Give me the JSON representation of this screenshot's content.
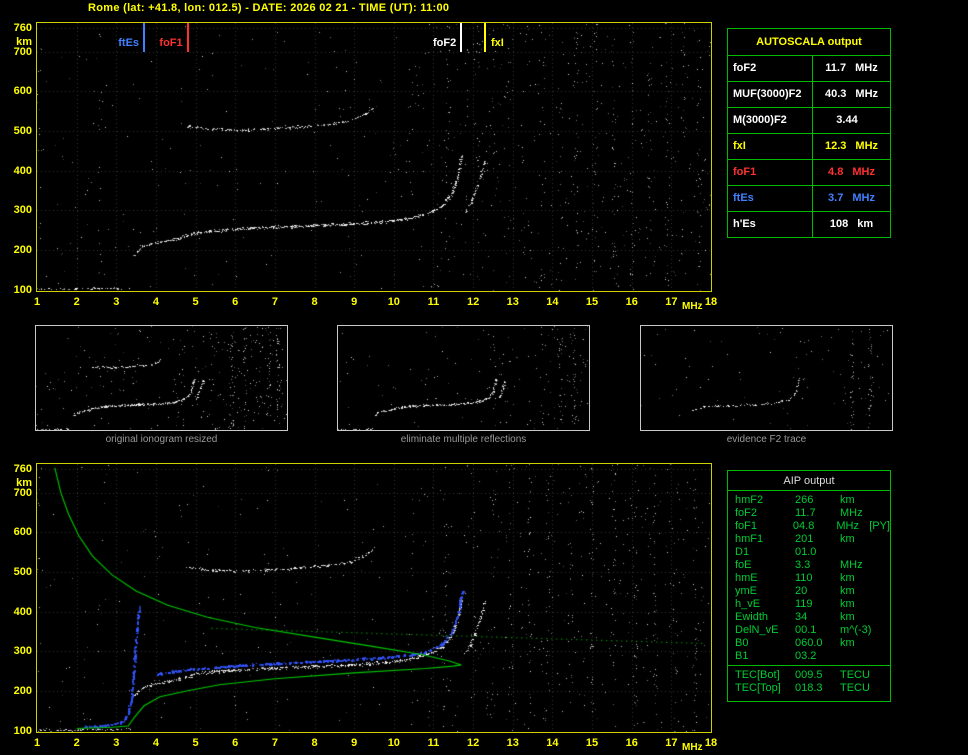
{
  "app": {
    "title": "Rome (lat: +41.8, lon: 012.5) - DATE: 2026 02 21 - TIME (UT): 11:00"
  },
  "autoscala_table": {
    "title": "AUTOSCALA output",
    "rows": [
      {
        "label": "foF2",
        "value": "11.7",
        "unit": "MHz",
        "color": "#ffffff"
      },
      {
        "label": "MUF(3000)F2",
        "value": "40.3",
        "unit": "MHz",
        "color": "#ffffff"
      },
      {
        "label": "M(3000)F2",
        "value": "3.44",
        "unit": "",
        "color": "#ffffff"
      },
      {
        "label": "fxI",
        "value": "12.3",
        "unit": "MHz",
        "color": "#ffff00"
      },
      {
        "label": "foF1",
        "value": "4.8",
        "unit": "MHz",
        "color": "#ff3030"
      },
      {
        "label": "ftEs",
        "value": "3.7",
        "unit": "MHz",
        "color": "#4080ff"
      },
      {
        "label": "h'Es",
        "value": "108",
        "unit": "km",
        "color": "#ffffff"
      }
    ]
  },
  "aip_table": {
    "title": "AIP output",
    "rows": [
      {
        "label": "hmF2",
        "value": "266",
        "unit": "km"
      },
      {
        "label": "foF2",
        "value": "11.7",
        "unit": "MHz"
      },
      {
        "label": "foF1",
        "value": "04.8",
        "unit": "MHz",
        "note": "[PY]"
      },
      {
        "label": "hmF1",
        "value": "201",
        "unit": "km"
      },
      {
        "label": "D1",
        "value": "01.0",
        "unit": ""
      },
      {
        "label": "foE",
        "value": "3.3",
        "unit": "MHz"
      },
      {
        "label": "hmE",
        "value": "110",
        "unit": "km"
      },
      {
        "label": "ymE",
        "value": "20",
        "unit": "km"
      },
      {
        "label": "h_vE",
        "value": "119",
        "unit": "km"
      },
      {
        "label": "Ewidth",
        "value": "34",
        "unit": "km"
      },
      {
        "label": "DelN_vE",
        "value": "00.1",
        "unit": "m^(-3)"
      },
      {
        "label": "B0",
        "value": "060.0",
        "unit": "km"
      },
      {
        "label": "B1",
        "value": "03.2",
        "unit": ""
      }
    ],
    "tec_rows": [
      {
        "label": "TEC[Bot]",
        "value": "009.5",
        "unit": "TECU"
      },
      {
        "label": "TEC[Top]",
        "value": "018.3",
        "unit": "TECU"
      }
    ]
  },
  "thumbnails": [
    {
      "caption": "original ionogram resized"
    },
    {
      "caption": "eliminate multiple reflections"
    },
    {
      "caption": "evidence F2 trace"
    }
  ],
  "chart_data": [
    {
      "id": "main_ionogram",
      "type": "scatter",
      "title": "vertical incidence ionogram",
      "xlabel": "MHz",
      "ylabel": "km",
      "xlim": [
        1,
        18
      ],
      "ylim": [
        97,
        772
      ],
      "x_ticks": [
        1,
        2,
        3,
        4,
        5,
        6,
        7,
        8,
        9,
        10,
        11,
        12,
        13,
        14,
        15,
        16,
        17,
        18
      ],
      "y_ticks": [
        760,
        700,
        600,
        500,
        400,
        300,
        200,
        100
      ],
      "grid": true,
      "markers": [
        {
          "label": "ftEs",
          "freq_mhz": 3.7,
          "color": "#4080ff",
          "label_side": "left"
        },
        {
          "label": "foF1",
          "freq_mhz": 4.8,
          "color": "#ff3030",
          "label_side": "left"
        },
        {
          "label": "foF2",
          "freq_mhz": 11.7,
          "color": "#ffffff",
          "label_side": "left"
        },
        {
          "label": "fxI",
          "freq_mhz": 12.3,
          "color": "#ffff00",
          "label_side": "right"
        }
      ],
      "traces": [
        {
          "name": "Es-layer",
          "color": "#ffffff",
          "density": 0.5,
          "spread": 1.2,
          "points": [
            [
              1.0,
              102
            ],
            [
              1.7,
              103
            ],
            [
              2.5,
              104
            ],
            [
              3.35,
              105
            ]
          ]
        },
        {
          "name": "EF-cusp",
          "color": "#ffffff",
          "density": 1.1,
          "spread": 1.7,
          "points": [
            [
              3.45,
              188
            ],
            [
              3.6,
              206
            ],
            [
              3.85,
              217
            ],
            [
              4.15,
              222
            ],
            [
              4.45,
              227
            ]
          ]
        },
        {
          "name": "F-trace",
          "color": "#ffffff",
          "density": 1.4,
          "spread": 1.8,
          "points": [
            [
              4.45,
              227
            ],
            [
              5.0,
              244
            ],
            [
              5.6,
              251
            ],
            [
              6.6,
              257
            ],
            [
              7.6,
              261
            ],
            [
              8.6,
              265
            ],
            [
              9.6,
              271
            ],
            [
              10.3,
              279
            ],
            [
              10.8,
              291
            ],
            [
              11.2,
              311
            ],
            [
              11.45,
              341
            ],
            [
              11.6,
              381
            ],
            [
              11.7,
              436
            ]
          ]
        },
        {
          "name": "X-fork",
          "color": "#ffffff",
          "density": 0.9,
          "spread": 1.4,
          "points": [
            [
              11.8,
              295
            ],
            [
              12.0,
              335
            ],
            [
              12.18,
              385
            ],
            [
              12.3,
              428
            ]
          ]
        },
        {
          "name": "second-hop",
          "color": "#ffffff",
          "density": 0.85,
          "spread": 1.6,
          "points": [
            [
              4.75,
              513
            ],
            [
              5.3,
              506
            ],
            [
              6.2,
              503
            ],
            [
              7.2,
              508
            ],
            [
              8.1,
              515
            ],
            [
              8.9,
              526
            ],
            [
              9.3,
              545
            ],
            [
              9.5,
              562
            ]
          ]
        }
      ],
      "noise": {
        "seed": 7,
        "uniform": 620,
        "columns": [
          1.06,
          2.6,
          11.35,
          12.15,
          12.55,
          12.9,
          13.3,
          13.75,
          14.2,
          14.6,
          15.1,
          15.55,
          16.0,
          16.45,
          16.9,
          17.3,
          17.7
        ]
      }
    },
    {
      "id": "profile_ionogram",
      "type": "scatter",
      "title": "ionogram with AIP electron density profile and autoscaled trace",
      "xlabel": "MHz",
      "ylabel": "km",
      "xlim": [
        1,
        18
      ],
      "ylim": [
        97,
        772
      ],
      "x_ticks": [
        1,
        2,
        3,
        4,
        5,
        6,
        7,
        8,
        9,
        10,
        11,
        12,
        13,
        14,
        15,
        16,
        17,
        18
      ],
      "y_ticks": [
        760,
        700,
        600,
        500,
        400,
        300,
        200,
        100
      ],
      "grid": true,
      "uses": [
        "Es-layer",
        "EF-cusp",
        "F-trace",
        "X-fork",
        "second-hop"
      ],
      "profile": {
        "color": "#00c800",
        "topside": [
          [
            1.45,
            762
          ],
          [
            1.6,
            700
          ],
          [
            1.8,
            645
          ],
          [
            2.05,
            592
          ],
          [
            2.4,
            540
          ],
          [
            2.9,
            492
          ],
          [
            3.5,
            452
          ],
          [
            4.3,
            416
          ],
          [
            5.3,
            386
          ],
          [
            6.5,
            360
          ],
          [
            8.0,
            336
          ],
          [
            9.5,
            312
          ],
          [
            10.7,
            292
          ],
          [
            11.4,
            276
          ],
          [
            11.7,
            266
          ]
        ],
        "bottomside": [
          [
            2.0,
            106
          ],
          [
            2.9,
            109
          ],
          [
            3.3,
            112
          ],
          [
            3.45,
            133
          ],
          [
            3.7,
            163
          ],
          [
            4.1,
            186
          ],
          [
            4.8,
            201
          ],
          [
            5.6,
            216
          ],
          [
            7.0,
            231
          ],
          [
            9.0,
            246
          ],
          [
            10.8,
            257
          ],
          [
            11.5,
            263
          ],
          [
            11.7,
            266
          ]
        ],
        "dotted": [
          [
            5.4,
            358
          ],
          [
            17.8,
            320
          ]
        ]
      },
      "scaled_trace": [
        {
          "name": "auto-E",
          "color": "#3355ff",
          "density": 1.2,
          "spread": 1.2,
          "dot": 2,
          "points": [
            [
              2.2,
              112
            ],
            [
              2.7,
              114
            ],
            [
              3.0,
              119
            ],
            [
              3.2,
              129
            ],
            [
              3.3,
              150
            ],
            [
              3.38,
              192
            ],
            [
              3.43,
              248
            ],
            [
              3.47,
              308
            ],
            [
              3.52,
              372
            ],
            [
              3.56,
              412
            ]
          ]
        },
        {
          "name": "auto-F",
          "color": "#3355ff",
          "density": 1.2,
          "spread": 1.2,
          "dot": 2,
          "points": [
            [
              4.0,
              245
            ],
            [
              5.0,
              257
            ],
            [
              6.0,
              265
            ],
            [
              7.0,
              271
            ],
            [
              8.0,
              276
            ],
            [
              9.0,
              281
            ],
            [
              10.0,
              288
            ],
            [
              10.8,
              299
            ],
            [
              11.2,
              319
            ],
            [
              11.45,
              349
            ],
            [
              11.6,
              391
            ],
            [
              11.68,
              433
            ],
            [
              11.73,
              457
            ]
          ]
        }
      ],
      "noise": {
        "seed": 11,
        "uniform": 560,
        "columns": [
          1.06,
          11.3,
          12.5,
          12.95,
          13.4,
          13.9,
          14.45,
          15.0,
          15.55,
          16.1,
          16.6,
          17.1,
          17.6
        ]
      }
    },
    {
      "id": "thumb_original",
      "type": "scatter",
      "title": "original ionogram resized",
      "xlim": [
        1,
        18
      ],
      "ylim": [
        97,
        772
      ],
      "grid": false,
      "uses": [
        "Es-layer",
        "EF-cusp",
        "F-trace",
        "X-fork",
        "second-hop"
      ],
      "density_scale": 1.0,
      "noise": {
        "seed": 21,
        "uniform": 280,
        "columns": [
          14.3,
          15.2,
          16.0,
          16.8,
          17.4
        ]
      }
    },
    {
      "id": "thumb_cleaned",
      "type": "scatter",
      "title": "eliminate multiple reflections",
      "xlim": [
        1,
        18
      ],
      "ylim": [
        97,
        772
      ],
      "grid": false,
      "uses": [
        "Es-layer",
        "EF-cusp",
        "F-trace",
        "X-fork"
      ],
      "density_scale": 0.9,
      "noise": {
        "seed": 22,
        "uniform": 150,
        "columns": [
          14.9,
          16.1,
          17.0
        ]
      }
    },
    {
      "id": "thumb_f2",
      "type": "scatter",
      "title": "evidence F2 trace",
      "xlim": [
        1,
        18
      ],
      "ylim": [
        97,
        772
      ],
      "grid": false,
      "uses": [
        "F-trace"
      ],
      "density_scale": 0.5,
      "noise": {
        "seed": 23,
        "uniform": 90,
        "columns": [
          15.3,
          16.5
        ]
      }
    }
  ]
}
